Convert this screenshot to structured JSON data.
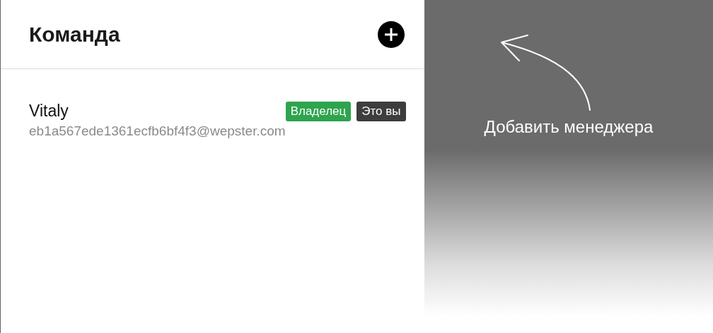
{
  "panel": {
    "title": "Команда"
  },
  "members": [
    {
      "name": "Vitaly",
      "email": "eb1a567ede1361ecfb6bf4f3@wepster.com",
      "badges": [
        {
          "label": "Владелец",
          "color": "#2ea44f"
        },
        {
          "label": "Это вы",
          "color": "#3d3d3d"
        }
      ]
    }
  ],
  "hint": {
    "text": "Добавить менеджера"
  }
}
